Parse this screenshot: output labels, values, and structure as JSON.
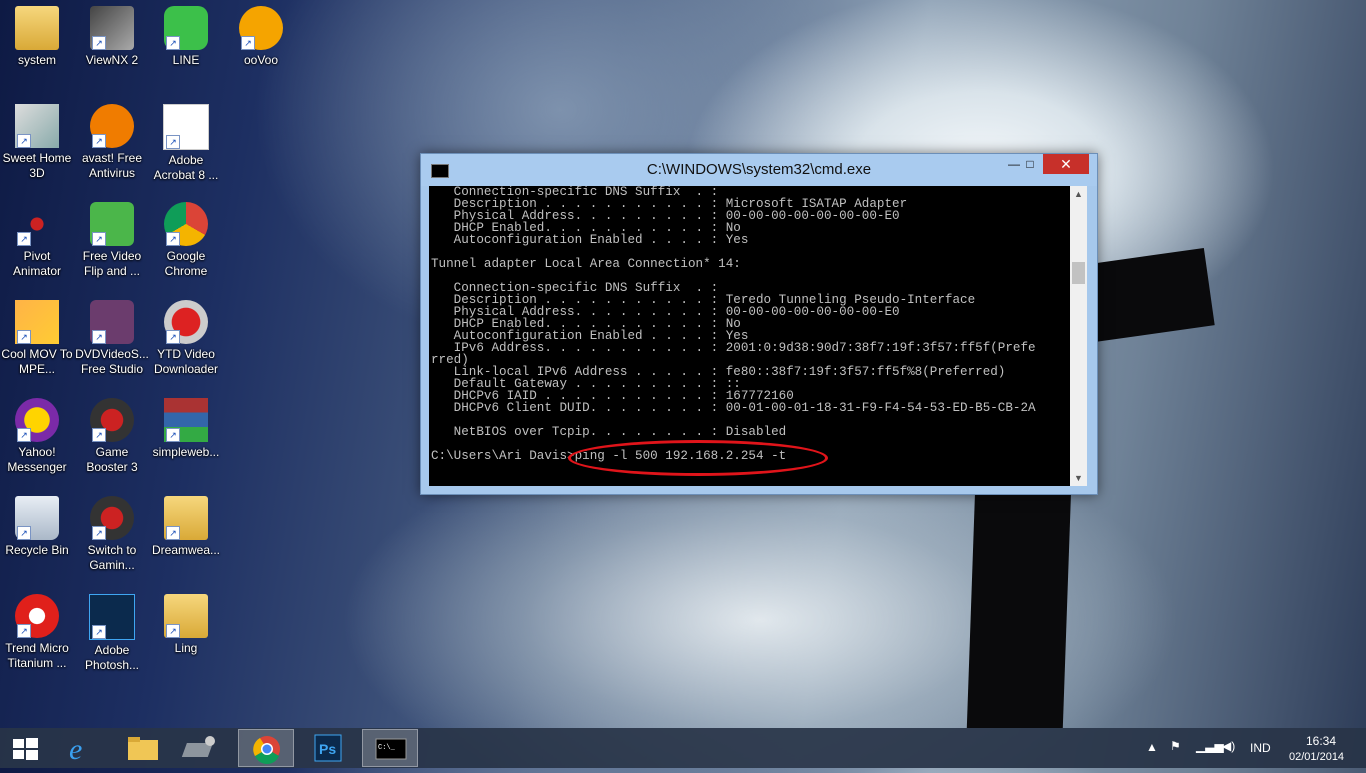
{
  "desktop": {
    "icons": [
      {
        "label": "system",
        "icon": "folder-icon"
      },
      {
        "label": "ViewNX 2",
        "icon": "viewnx-icon"
      },
      {
        "label": "LINE",
        "icon": "line-icon"
      },
      {
        "label": "ooVoo",
        "icon": "oovoo-icon"
      },
      {
        "label": "Sweet Home 3D",
        "icon": "sweet-home-icon"
      },
      {
        "label": "avast! Free Antivirus",
        "icon": "avast-icon"
      },
      {
        "label": "Adobe Acrobat 8 ...",
        "icon": "acrobat-icon"
      },
      {
        "label": "Pivot Animator",
        "icon": "pivot-icon"
      },
      {
        "label": "Free Video Flip and ...",
        "icon": "video-flip-icon"
      },
      {
        "label": "Google Chrome",
        "icon": "chrome-icon"
      },
      {
        "label": "Cool MOV To MPE...",
        "icon": "cool-mov-icon"
      },
      {
        "label": "DVDVideoS... Free Studio",
        "icon": "free-studio-icon"
      },
      {
        "label": "YTD Video Downloader",
        "icon": "ytd-icon"
      },
      {
        "label": "Yahoo! Messenger",
        "icon": "yahoo-messenger-icon"
      },
      {
        "label": "Game Booster 3",
        "icon": "game-booster-icon"
      },
      {
        "label": "simpleweb...",
        "icon": "winrar-icon"
      },
      {
        "label": "Recycle Bin",
        "icon": "recycle-bin-icon"
      },
      {
        "label": "Switch to Gamin...",
        "icon": "switch-gaming-icon"
      },
      {
        "label": "Dreamwea...",
        "icon": "folder-icon"
      },
      {
        "label": "Trend Micro Titanium ...",
        "icon": "trend-micro-icon"
      },
      {
        "label": "Adobe Photosh...",
        "icon": "photoshop-icon"
      },
      {
        "label": "Ling",
        "icon": "folder-icon"
      }
    ]
  },
  "cmd_window": {
    "title": "C:\\WINDOWS\\system32\\cmd.exe",
    "minimize": "—",
    "maximize": "□",
    "close": "✕",
    "lines": [
      "   Connection-specific DNS Suffix  . :",
      "   Description . . . . . . . . . . . : Microsoft ISATAP Adapter",
      "   Physical Address. . . . . . . . . : 00-00-00-00-00-00-00-E0",
      "   DHCP Enabled. . . . . . . . . . . : No",
      "   Autoconfiguration Enabled . . . . : Yes",
      "",
      "Tunnel adapter Local Area Connection* 14:",
      "",
      "   Connection-specific DNS Suffix  . :",
      "   Description . . . . . . . . . . . : Teredo Tunneling Pseudo-Interface",
      "   Physical Address. . . . . . . . . : 00-00-00-00-00-00-00-E0",
      "   DHCP Enabled. . . . . . . . . . . : No",
      "   Autoconfiguration Enabled . . . . : Yes",
      "   IPv6 Address. . . . . . . . . . . : 2001:0:9d38:90d7:38f7:19f:3f57:ff5f(Prefe",
      "rred)",
      "   Link-local IPv6 Address . . . . . : fe80::38f7:19f:3f57:ff5f%8(Preferred)",
      "   Default Gateway . . . . . . . . . : ::",
      "   DHCPv6 IAID . . . . . . . . . . . : 167772160",
      "   DHCPv6 Client DUID. . . . . . . . : 00-01-00-01-18-31-F9-F4-54-53-ED-B5-CB-2A",
      "",
      "   NetBIOS over Tcpip. . . . . . . . : Disabled",
      "",
      "C:\\Users\\Ari Davis>ping -l 500 192.168.2.254 -t"
    ]
  },
  "taskbar": {
    "items": [
      {
        "name": "start-button",
        "icon": "windows-logo-icon"
      },
      {
        "name": "taskbar-internet-explorer",
        "icon": "internet-explorer-icon"
      },
      {
        "name": "taskbar-file-explorer",
        "icon": "file-explorer-icon"
      },
      {
        "name": "taskbar-control-panel",
        "icon": "control-panel-icon"
      },
      {
        "name": "taskbar-chrome",
        "icon": "chrome-icon"
      },
      {
        "name": "taskbar-photoshop",
        "icon": "photoshop-icon"
      },
      {
        "name": "taskbar-cmd",
        "icon": "cmd-icon"
      }
    ],
    "tray": {
      "language": "IND",
      "time": "16:34",
      "date": "02/01/2014"
    }
  },
  "colors": {
    "highlight_oval": "#e0141a",
    "close_button": "#c7302a",
    "console_bg": "#000000",
    "console_text": "#c0c0c0"
  }
}
